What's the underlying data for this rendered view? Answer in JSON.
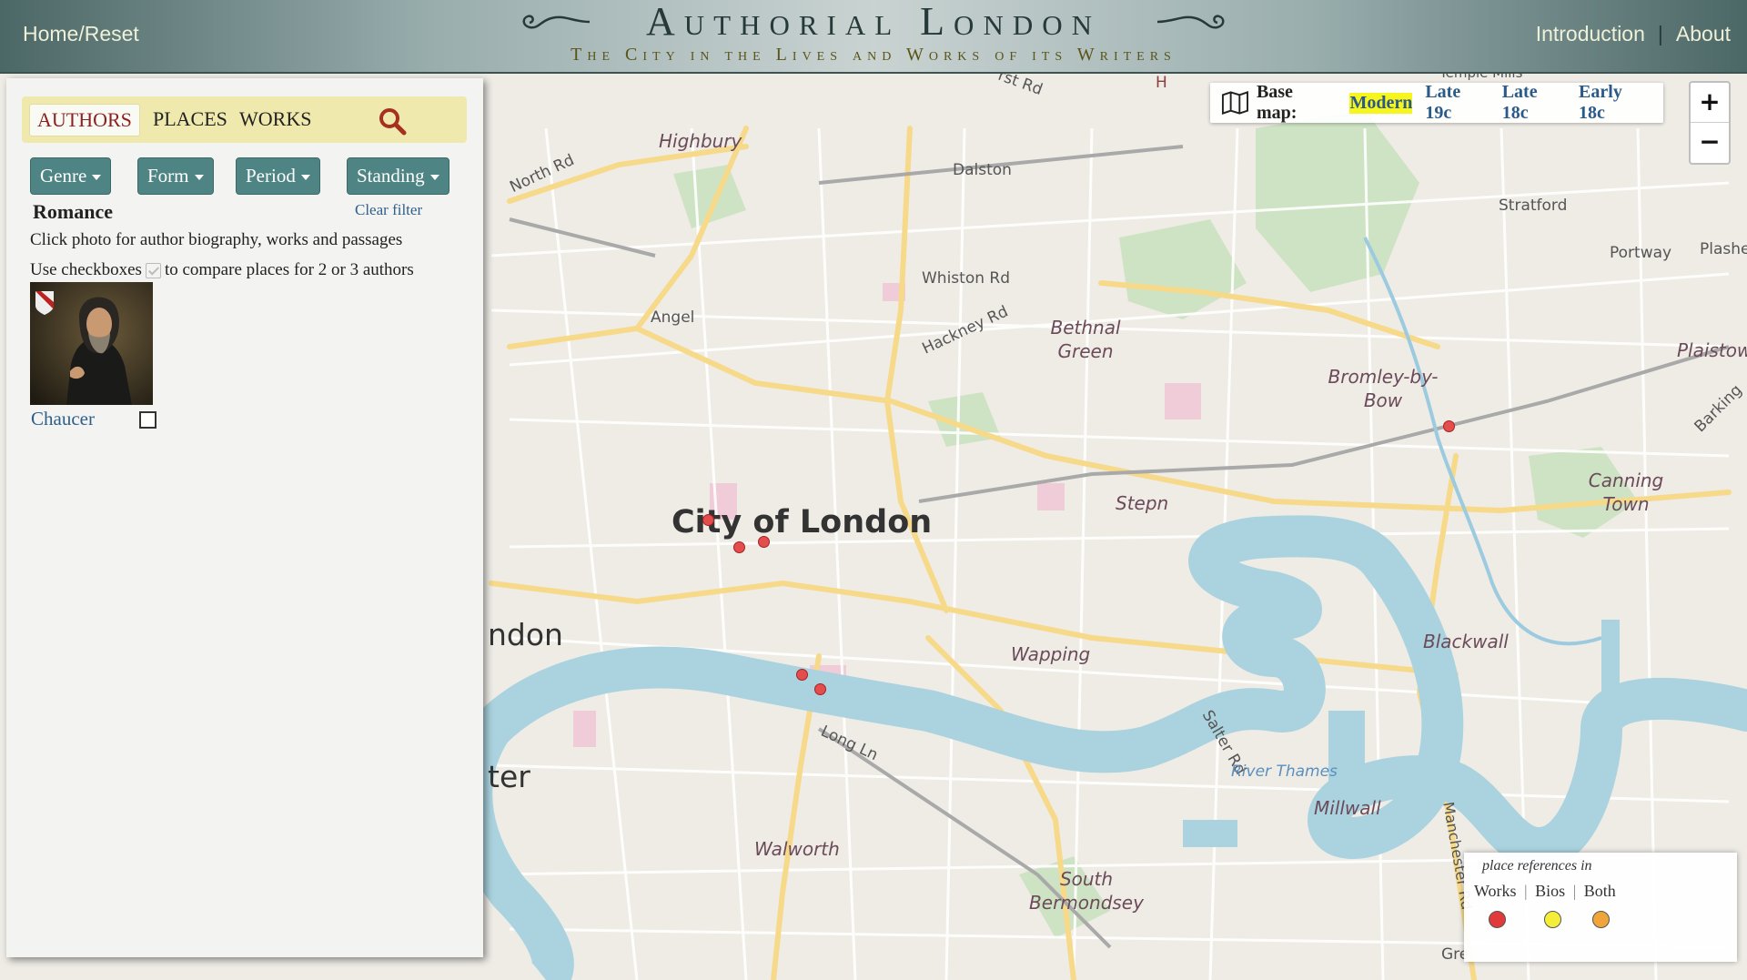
{
  "header": {
    "home_label": "Home/Reset",
    "title": "Authorial London",
    "subtitle": "The City in the Lives and Works of its Writers",
    "nav": {
      "introduction": "Introduction",
      "separator": "|",
      "about": "About"
    }
  },
  "sidebar": {
    "tabs": {
      "authors": "AUTHORS",
      "places": "PLACES",
      "works": "WORKS"
    },
    "active_tab": "authors",
    "filters": {
      "genre": "Genre",
      "form": "Form",
      "period": "Period",
      "standing": "Standing"
    },
    "current_filter": "Romance",
    "clear_filter": "Clear filter",
    "help_line1": "Click photo for author biography, works and passages",
    "help_line2_a": "Use checkboxes",
    "help_line2_b": "to compare places for 2 or 3 authors",
    "authors": [
      {
        "name": "Chaucer",
        "checked": false
      }
    ]
  },
  "basemap": {
    "label": "Base map:",
    "options": [
      "Modern",
      "Late 19c",
      "Late 18c",
      "Early 18c"
    ],
    "active": "Modern"
  },
  "zoom": {
    "in": "+",
    "out": "−"
  },
  "map": {
    "district_labels": [
      "Highbury",
      "Dalston",
      "Stratford",
      "Portway",
      "Plashe",
      "Angel",
      "Whiston Rd",
      "Hackney Rd",
      "Bethnal Green",
      "Bromley-by-Bow",
      "Plaistow",
      "Barking",
      "Canning Town",
      "City of London",
      "Stepn",
      "Wapping",
      "Salter Rd",
      "Blackwall",
      "ndon",
      "ter",
      "Long Ln",
      "River Thames",
      "Millwall",
      "Manchester Rd",
      "Walworth",
      "South Bermondsey",
      "North Rd",
      "rst Rd",
      "H",
      "Gre",
      "Temple Mills"
    ]
  },
  "legend": {
    "title": "place references in",
    "works": "Works",
    "bios": "Bios",
    "both": "Both",
    "sep": "|",
    "colors": {
      "works": "#e03a3a",
      "bios": "#f4ee3a",
      "both": "#f0a53a"
    }
  },
  "colors": {
    "header_dark": "#4b6766",
    "button": "#4e8584",
    "tab_bg": "#f0e9ad",
    "active_tab_text": "#8b2222",
    "marker": "#e34d4d",
    "water": "#aad3df"
  }
}
